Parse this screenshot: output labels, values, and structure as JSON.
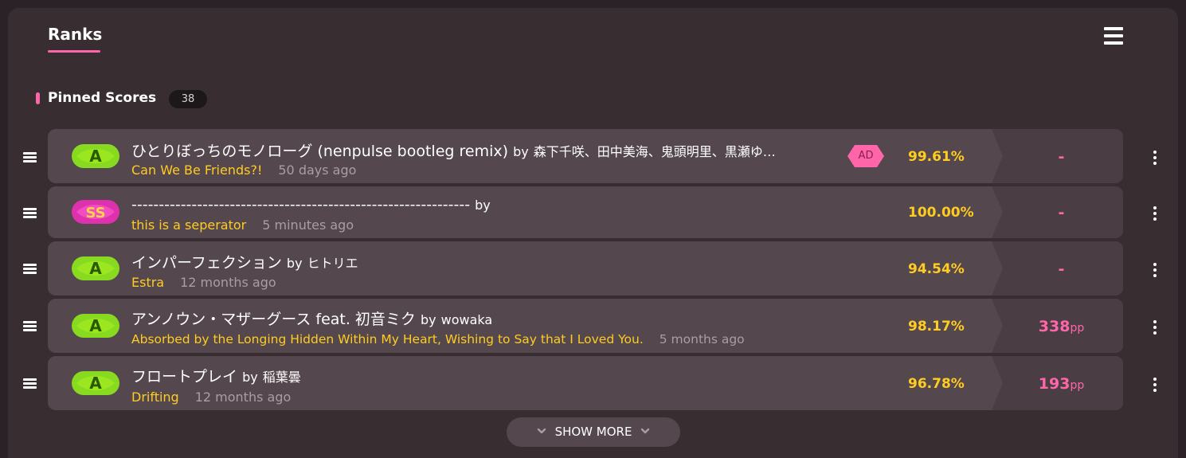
{
  "header": {
    "tab_label": "Ranks",
    "menu_icon": "hamburger-menu-icon"
  },
  "section": {
    "title": "Pinned Scores",
    "count": "38"
  },
  "colors": {
    "accent_pink": "#ff66aa",
    "difficulty_yellow": "#ffcc22",
    "grade_a_green": "#88da20",
    "grade_ss_pink": "#de31ae"
  },
  "scores": [
    {
      "grade": "A",
      "title": "ひとりぼっちのモノローグ (nenpulse bootleg remix)",
      "by_label": "by",
      "artist": "森下千咲、田中美海、鬼頭明里、黒瀬ゆ…",
      "difficulty": "Can We Be Friends?!",
      "time": "50 days ago",
      "mod": "AD",
      "accuracy": "99.61%",
      "pp": "-",
      "pp_unit": ""
    },
    {
      "grade": "SS",
      "title": "--------------------------------------------------------------",
      "by_label": "by",
      "artist": "",
      "difficulty": "this is a seperator",
      "time": "5 minutes ago",
      "mod": "",
      "accuracy": "100.00%",
      "pp": "-",
      "pp_unit": ""
    },
    {
      "grade": "A",
      "title": "インパーフェクション",
      "by_label": "by",
      "artist": "ヒトリエ",
      "difficulty": "Estra",
      "time": "12 months ago",
      "mod": "",
      "accuracy": "94.54%",
      "pp": "-",
      "pp_unit": ""
    },
    {
      "grade": "A",
      "title": "アンノウン・マザーグース feat. 初音ミク",
      "by_label": "by",
      "artist": "wowaka",
      "difficulty": "Absorbed by the Longing Hidden Within My Heart, Wishing to Say that I Loved You.",
      "time": "5 months ago",
      "mod": "",
      "accuracy": "98.17%",
      "pp": "338",
      "pp_unit": "pp"
    },
    {
      "grade": "A",
      "title": "フロートプレイ",
      "by_label": "by",
      "artist": "稲葉曇",
      "difficulty": "Drifting",
      "time": "12 months ago",
      "mod": "",
      "accuracy": "96.78%",
      "pp": "193",
      "pp_unit": "pp"
    }
  ],
  "show_more": {
    "label": "SHOW MORE"
  }
}
